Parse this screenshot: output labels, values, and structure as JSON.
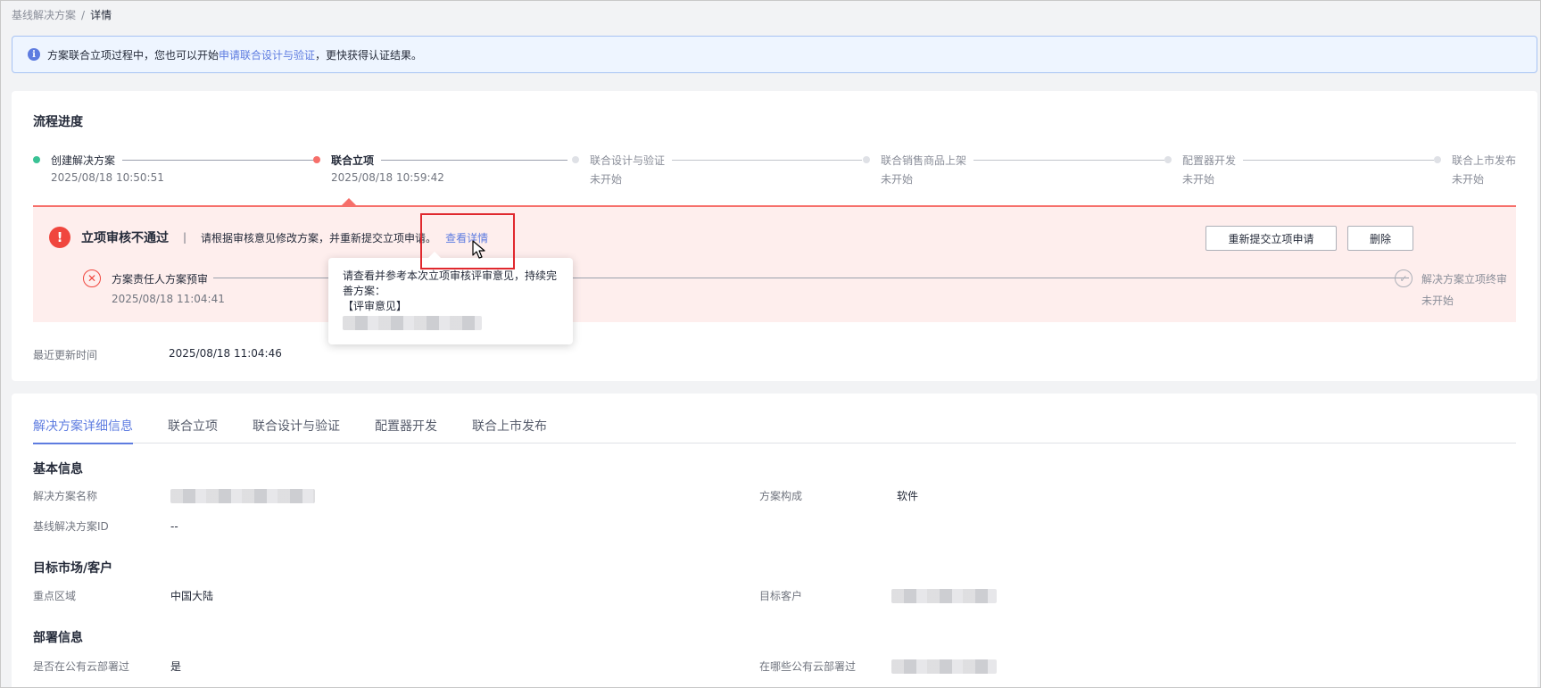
{
  "breadcrumb": {
    "parent": "基线解决方案",
    "separator": "/",
    "current": "详情"
  },
  "notice": {
    "prefix": "方案联合立项过程中，您也可以开始",
    "link": "申请联合设计与验证",
    "suffix": "，更快获得认证结果。"
  },
  "progress": {
    "title": "流程进度",
    "steps": [
      {
        "label": "创建解决方案",
        "sub": "2025/08/18 10:50:51",
        "status": "done"
      },
      {
        "label": "联合立项",
        "sub": "2025/08/18 10:59:42",
        "status": "error"
      },
      {
        "label": "联合设计与验证",
        "sub": "未开始",
        "status": "pending"
      },
      {
        "label": "联合销售商品上架",
        "sub": "未开始",
        "status": "pending"
      },
      {
        "label": "配置器开发",
        "sub": "未开始",
        "status": "pending"
      },
      {
        "label": "联合上市发布",
        "sub": "未开始",
        "status": "pending"
      }
    ],
    "error": {
      "title": "立项审核不通过",
      "separator": "|",
      "desc": "请根据审核意见修改方案，并重新提交立项申请。",
      "link": "查看详情",
      "resubmit_label": "重新提交立项申请",
      "delete_label": "删除",
      "substeps": [
        {
          "label": "方案责任人方案预审",
          "sub": "2025/08/18 11:04:41"
        },
        {
          "label": "解决方案立项终审",
          "sub": "未开始"
        }
      ]
    },
    "updated_label": "最近更新时间",
    "updated_value": "2025/08/18 11:04:46"
  },
  "tooltip": {
    "line1": "请查看并参考本次立项审核评审意见，持续完善方案：",
    "line2": "【评审意见】"
  },
  "tabs": [
    {
      "label": "解决方案详细信息",
      "active": true
    },
    {
      "label": "联合立项",
      "active": false
    },
    {
      "label": "联合设计与验证",
      "active": false
    },
    {
      "label": "配置器开发",
      "active": false
    },
    {
      "label": "联合上市发布",
      "active": false
    }
  ],
  "details": {
    "basic_title": "基本信息",
    "name_label": "解决方案名称",
    "composition_label": "方案构成",
    "composition_value": "软件",
    "baseline_id_label": "基线解决方案ID",
    "baseline_id_value": "--",
    "market_title": "目标市场/客户",
    "region_label": "重点区域",
    "region_value": "中国大陆",
    "customer_label": "目标客户",
    "deploy_title": "部署信息",
    "public_cloud_label": "是否在公有云部署过",
    "public_cloud_value": "是",
    "which_cloud_label": "在哪些公有云部署过"
  },
  "colors": {
    "primary": "#5e7ce0",
    "done": "#3ac295",
    "error": "#f66f6a",
    "error_bg": "#feeeed",
    "highlight": "#e0282e"
  }
}
